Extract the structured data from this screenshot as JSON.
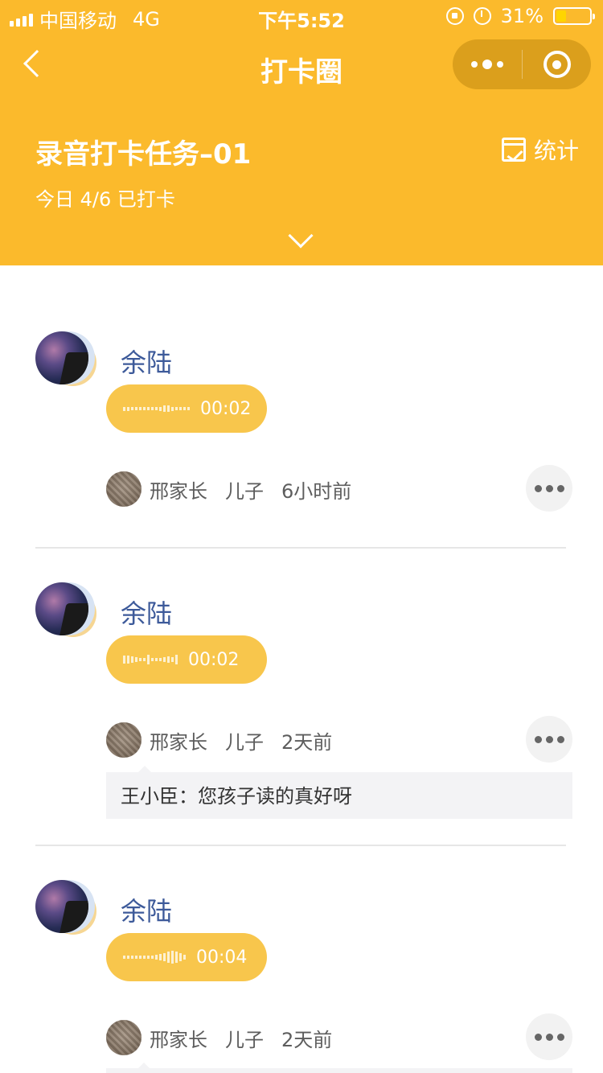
{
  "status_bar": {
    "carrier": "中国移动",
    "network": "4G",
    "time": "下午5:52",
    "battery": "31%",
    "battery_level": 0.31
  },
  "nav": {
    "title": "打卡圈",
    "back_icon": "chevron-left-icon",
    "more_icon": "more-dots-icon",
    "close_icon": "target-circle-icon"
  },
  "task": {
    "title": "录音打卡任务–01",
    "status": "今日 4/6 已打卡",
    "stats_label": "统计",
    "stats_icon": "calendar-chart-icon",
    "expand_icon": "chevron-down-icon"
  },
  "colors": {
    "header_bg": "#FBBA2C",
    "voice_bubble": "#F8C64C",
    "poster_name": "#3D5A9A"
  },
  "posts": [
    {
      "poster_name": "余陆",
      "duration": "00:02",
      "parent_name": "邢家长",
      "relation": "儿子",
      "time_ago": "6小时前",
      "comment": ""
    },
    {
      "poster_name": "余陆",
      "duration": "00:02",
      "parent_name": "邢家长",
      "relation": "儿子",
      "time_ago": "2天前",
      "comment": "王小臣：您孩子读的真好呀"
    },
    {
      "poster_name": "余陆",
      "duration": "00:04",
      "parent_name": "邢家长",
      "relation": "儿子",
      "time_ago": "2天前",
      "comment": ""
    }
  ]
}
